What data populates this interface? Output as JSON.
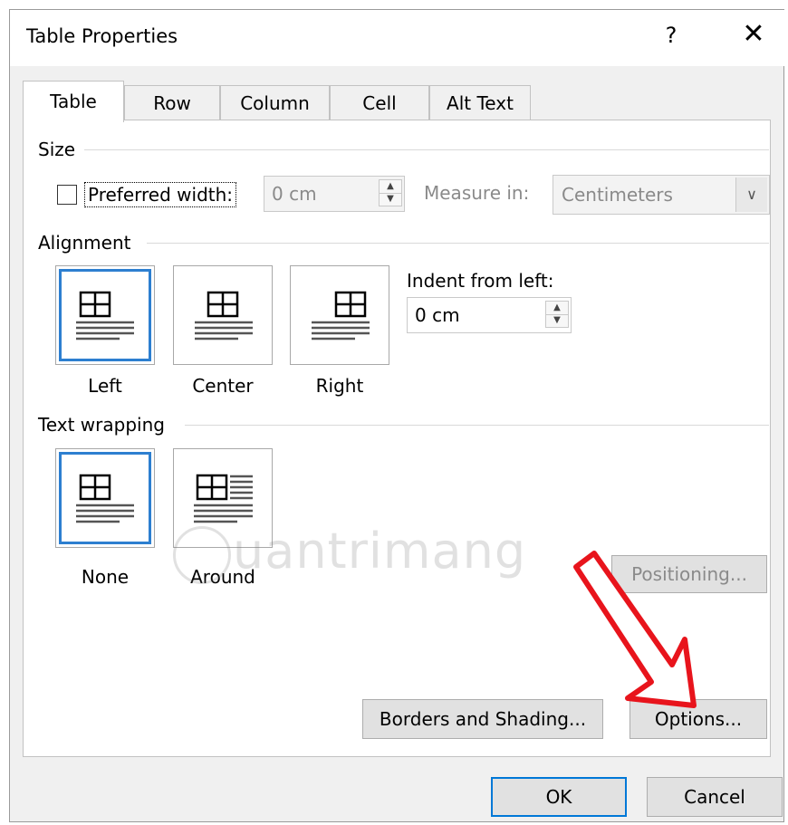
{
  "window": {
    "title": "Table Properties",
    "help_glyph": "?",
    "close_glyph": "✕"
  },
  "tabs": [
    {
      "label": "Table",
      "active": true
    },
    {
      "label": "Row",
      "active": false
    },
    {
      "label": "Column",
      "active": false
    },
    {
      "label": "Cell",
      "active": false
    },
    {
      "label": "Alt Text",
      "active": false
    }
  ],
  "size": {
    "group_label": "Size",
    "preferred_width_label": "Preferred width:",
    "preferred_width_checked": false,
    "preferred_width_value": "0 cm",
    "measure_in_label": "Measure in:",
    "measure_in_value": "Centimeters"
  },
  "alignment": {
    "group_label": "Alignment",
    "options": [
      {
        "label": "Left",
        "selected": true
      },
      {
        "label": "Center",
        "selected": false
      },
      {
        "label": "Right",
        "selected": false
      }
    ],
    "indent_label": "Indent from left:",
    "indent_value": "0 cm"
  },
  "text_wrapping": {
    "group_label": "Text wrapping",
    "options": [
      {
        "label": "None",
        "selected": true
      },
      {
        "label": "Around",
        "selected": false
      }
    ],
    "positioning_label": "Positioning..."
  },
  "buttons": {
    "borders_shading": "Borders and Shading...",
    "options": "Options...",
    "ok": "OK",
    "cancel": "Cancel"
  },
  "watermark": {
    "text": "uantrimang"
  },
  "colors": {
    "selection_border": "#2d7fd0",
    "arrow_red": "#e8141c",
    "primary_border": "#0078d7"
  }
}
